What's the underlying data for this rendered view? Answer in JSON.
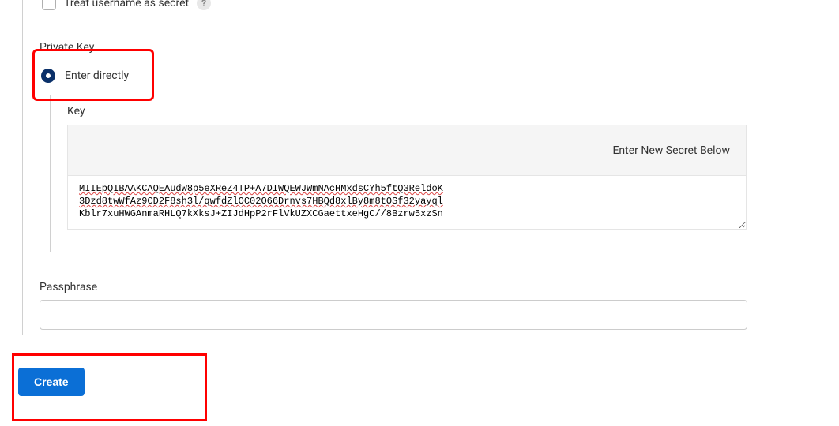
{
  "treatSecret": {
    "label": "Treat username as secret",
    "checked": false
  },
  "privateKey": {
    "sectionLabel": "Private Key",
    "radioLabel": "Enter directly",
    "radioSelected": true,
    "keyLabel": "Key",
    "bannerText": "Enter New Secret Below",
    "keyValueLine1": "MIIEpQIBAAKCAQEAudW8p5eXReZ4TP+A7DIWQEWJWmNAcHMxdsCYh5ftQ3ReldoK",
    "keyValueLine2": "3Dzd8twWfAz9CD2F8sh3l/qwfdZlOC02O66Drnvs7HBQd8xlBy8m8tOSf32yayql",
    "keyValueLine3": "Kblr7xuHWGAnmaRHLQ7kXksJ+ZIJdHpP2rFlVkUZXCGaettxeHgC//8Bzrw5xzSn"
  },
  "passphrase": {
    "label": "Passphrase",
    "value": ""
  },
  "createButton": {
    "label": "Create"
  }
}
